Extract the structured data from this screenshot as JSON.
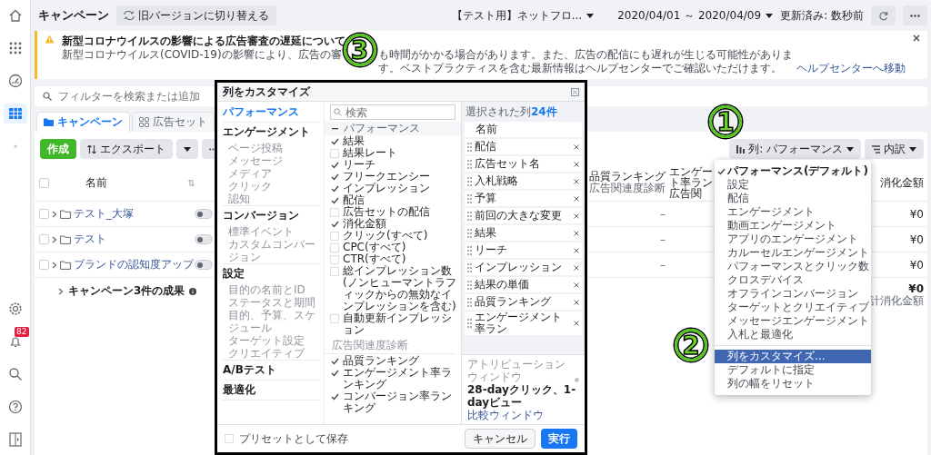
{
  "nav_items": [
    {
      "kind": "home",
      "selected": false
    },
    {
      "kind": "apps",
      "selected": false
    },
    {
      "kind": "gauge",
      "selected": false
    },
    {
      "kind": "table",
      "selected": true
    },
    {
      "kind": "dot",
      "selected": false
    }
  ],
  "nav_bottom": [
    {
      "kind": "settings"
    },
    {
      "kind": "bell",
      "badge": "82"
    },
    {
      "kind": "search"
    },
    {
      "kind": "help"
    },
    {
      "kind": "panel"
    }
  ],
  "top_bar": {
    "title": "キャンペーン",
    "switch_button": "旧バージョンに切り替える",
    "account": "【テスト用】ネットフロ...",
    "date_range": "2020/04/01 ～ 2020/04/09",
    "updated": "更新済み: 数秒前"
  },
  "banner": {
    "title": "新型コロナウイルスの影響による広告審査の遅延について",
    "text_before": "新型コロナウイルス(COVID-19)の影響により、広告の審",
    "text_after": "も時間がかかる場合があります。また、広告の配信にも遅れが生じる可能性があります。ベストプラクティスを含む最新情報はヘルプセンターでご確認いただけます。",
    "link": "ヘルプセンターへ移動"
  },
  "filter": {
    "placeholder": "フィルターを検索または追加"
  },
  "tabs": [
    {
      "label": "キャンペーン",
      "selected": true
    },
    {
      "label": "広告セット",
      "selected": false
    }
  ],
  "toolbar": {
    "create": "作成",
    "export": "エクスポート",
    "columns": "列: パフォーマンス",
    "breakdown": "内訳"
  },
  "table": {
    "select_all_checked": false,
    "name_column": "名前",
    "quality_column": {
      "label": "品質ランキング",
      "sub": "広告関連度診断"
    },
    "engagement_column": [
      "エンゲー",
      "ト率ラン",
      "広告関"
    ],
    "spend_column": "消化金額",
    "rows": [
      {
        "checked": false,
        "name": "テスト_大塚",
        "on": false,
        "quality": "–",
        "spend": "¥0"
      },
      {
        "checked": false,
        "name": "テスト",
        "on": false,
        "quality": "–",
        "spend": "¥0"
      },
      {
        "checked": false,
        "name": "ブランドの認知度アップ",
        "on": false,
        "quality": "–",
        "spend": "¥0"
      }
    ],
    "summary": {
      "label": "キャンペーン3件の成果",
      "spend": "¥0",
      "spend_label": "計消化金額"
    }
  },
  "dialog": {
    "title": "列をカスタマイズ",
    "sections": [
      {
        "label": "パフォーマンス",
        "selected": true
      },
      {
        "label": "エンゲージメント",
        "selected": false,
        "children": [
          {
            "label": "ページ投稿"
          },
          {
            "label": "メッセージ"
          },
          {
            "label": "メディア"
          },
          {
            "label": "クリック"
          },
          {
            "label": "認知"
          }
        ]
      },
      {
        "label": "コンバージョン",
        "selected": false,
        "children": [
          {
            "label": "標準イベント"
          },
          {
            "label": "カスタムコンバージョン"
          }
        ]
      },
      {
        "label": "設定",
        "selected": false,
        "children": [
          {
            "label": "目的の名前とID"
          },
          {
            "label": "ステータスと期間"
          },
          {
            "label": "目的、予算、スケジュール"
          },
          {
            "label": "ターゲット設定"
          },
          {
            "label": "クリエイティブ"
          }
        ]
      },
      {
        "label": "A/Bテスト",
        "selected": false
      },
      {
        "label": "最適化",
        "selected": false
      }
    ],
    "search": {
      "placeholder": "検索"
    },
    "groups": [
      {
        "title": "パフォーマンス",
        "kind": "collapsible",
        "items": [
          {
            "label": "結果",
            "checked": true
          },
          {
            "label": "結果レート",
            "checked": false
          },
          {
            "label": "リーチ",
            "checked": true
          },
          {
            "label": "フリークエンシー",
            "checked": true
          },
          {
            "label": "インプレッション",
            "checked": true
          },
          {
            "label": "配信",
            "checked": true
          },
          {
            "label": "広告セットの配信",
            "checked": false
          },
          {
            "label": "消化金額",
            "checked": true
          },
          {
            "label": "クリック(すべて)",
            "checked": false
          },
          {
            "label": "CPC(すべて)",
            "checked": false
          },
          {
            "label": "CTR(すべて)",
            "checked": false
          },
          {
            "label": "総インプレッション数(ノンヒューマントラフィックからの無効なインプレッションを含む)",
            "checked": false
          },
          {
            "label": "自動更新インプレッション",
            "checked": false
          }
        ]
      },
      {
        "title": "広告関連度診断",
        "kind": "plain",
        "items": [
          {
            "label": "品質ランキング",
            "checked": true
          },
          {
            "label": "エンゲージメント率ランキング",
            "checked": true
          },
          {
            "label": "コンバージョン率ランキング",
            "checked": true
          }
        ]
      }
    ],
    "selected_label": "選択された列",
    "selected_count": "24件",
    "selected_columns": [
      {
        "label": "名前",
        "kind": "fixed"
      },
      {
        "label": "配信",
        "kind": "removable"
      },
      {
        "label": "広告セット名",
        "kind": "removable"
      },
      {
        "label": "入札戦略",
        "kind": "removable"
      },
      {
        "label": "予算",
        "kind": "removable"
      },
      {
        "label": "前回の大きな変更",
        "kind": "removable"
      },
      {
        "label": "結果",
        "kind": "removable"
      },
      {
        "label": "リーチ",
        "kind": "removable"
      },
      {
        "label": "インプレッション",
        "kind": "removable"
      },
      {
        "label": "結果の単価",
        "kind": "removable"
      },
      {
        "label": "品質ランキング",
        "kind": "removable"
      },
      {
        "label": "エンゲージメント率ラン",
        "kind": "removable"
      }
    ],
    "attribution": {
      "label": "アトリビューションウィンドウ",
      "value": "28-dayクリック、1-dayビュー",
      "link": "比較ウィンドウ"
    },
    "preset": {
      "label": "プリセットとして保存",
      "checked": false
    },
    "cancel": "キャンセル",
    "apply": "実行"
  },
  "dropdown": {
    "items": [
      {
        "label": "パフォーマンス(デフォルト)",
        "selected": true
      },
      {
        "label": "設定",
        "selected": false
      },
      {
        "label": "配信",
        "selected": false
      },
      {
        "label": "エンゲージメント",
        "selected": false
      },
      {
        "label": "動画エンゲージメント",
        "selected": false
      },
      {
        "label": "アプリのエンゲージメント",
        "selected": false
      },
      {
        "label": "カルーセルエンゲージメント",
        "selected": false
      },
      {
        "label": "パフォーマンスとクリック数",
        "selected": false
      },
      {
        "label": "クロスデバイス",
        "selected": false
      },
      {
        "label": "オフラインコンバージョン",
        "selected": false
      },
      {
        "label": "ターゲットとクリエイティブ",
        "selected": false
      },
      {
        "label": "メッセージエンゲージメント",
        "selected": false
      },
      {
        "label": "入札と最適化",
        "selected": false
      }
    ],
    "actions": [
      {
        "label": "列をカスタマイズ...",
        "highlighted": true
      },
      {
        "label": "デフォルトに指定",
        "highlighted": false
      },
      {
        "label": "列の幅をリセット",
        "highlighted": false
      }
    ]
  },
  "annotations": [
    {
      "label": "1"
    },
    {
      "label": "2"
    },
    {
      "label": "3"
    }
  ]
}
